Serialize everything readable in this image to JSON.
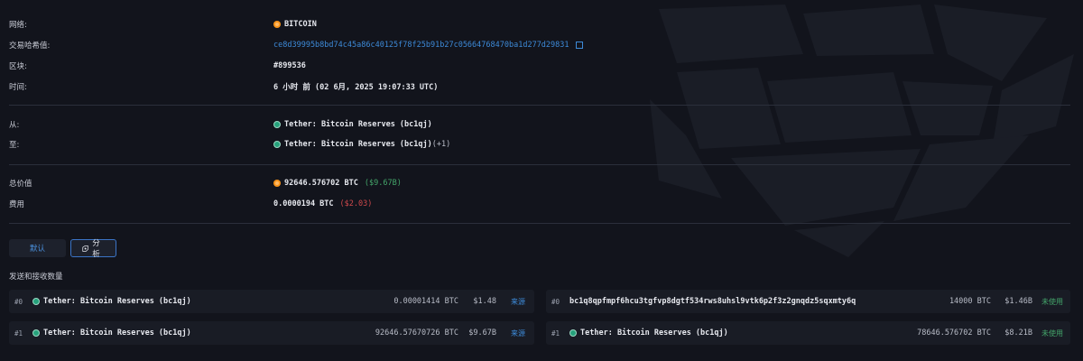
{
  "details": {
    "network": {
      "label": "网络:",
      "value": "BITCOIN"
    },
    "tx_hash": {
      "label": "交易哈希值:",
      "value": "ce8d39995b8bd74c45a86c40125f78f25b91b27c05664768470ba1d277d29831"
    },
    "block": {
      "label": "区块:",
      "value": "#899536"
    },
    "time": {
      "label": "时间:",
      "value": "6 小时 前 (02 6月, 2025 19:07:33 UTC)"
    },
    "from": {
      "label": "从:",
      "value": "Tether: Bitcoin Reserves (bc1qj)"
    },
    "to": {
      "label": "至:",
      "value": "Tether: Bitcoin Reserves (bc1qj)",
      "extra": "(+1)"
    },
    "total_value": {
      "label": "总价值",
      "value": "92646.576702 BTC",
      "usd": "($9.67B)"
    },
    "fee": {
      "label": "费用",
      "value": "0.0000194 BTC",
      "usd": "($2.03)"
    }
  },
  "tabs": {
    "default_label": "默认",
    "analysis_label": "分析"
  },
  "section_title": "发送和接收数量",
  "inputs": [
    {
      "idx": "#0",
      "address": "Tether: Bitcoin Reserves (bc1qj)",
      "amount": "0.00001414 BTC",
      "usd": "$1.48",
      "tag": "来源"
    },
    {
      "idx": "#1",
      "address": "Tether: Bitcoin Reserves (bc1qj)",
      "amount": "92646.57670726 BTC",
      "usd": "$9.67B",
      "tag": "来源"
    }
  ],
  "outputs": [
    {
      "idx": "#0",
      "address": "bc1q8qpfmpf6hcu3tgfvp8dgtf534rws8uhsl9vtk6p2f3z2gnqdz5sqxmty6q",
      "amount": "14000 BTC",
      "usd": "$1.46B",
      "tag": "未使用"
    },
    {
      "idx": "#1",
      "address": "Tether: Bitcoin Reserves (bc1qj)",
      "amount": "78646.576702 BTC",
      "usd": "$8.21B",
      "tag": "未使用"
    }
  ],
  "icons": {
    "btc": "bitcoin-icon",
    "usdt": "tether-icon",
    "external": "external-link-icon",
    "analysis": "analysis-icon"
  },
  "colors": {
    "background": "#12141c",
    "link": "#3d8ad8",
    "positive": "#44a56a",
    "negative": "#d0494c",
    "btc": "#f7931a",
    "usdt": "#26a17b"
  }
}
